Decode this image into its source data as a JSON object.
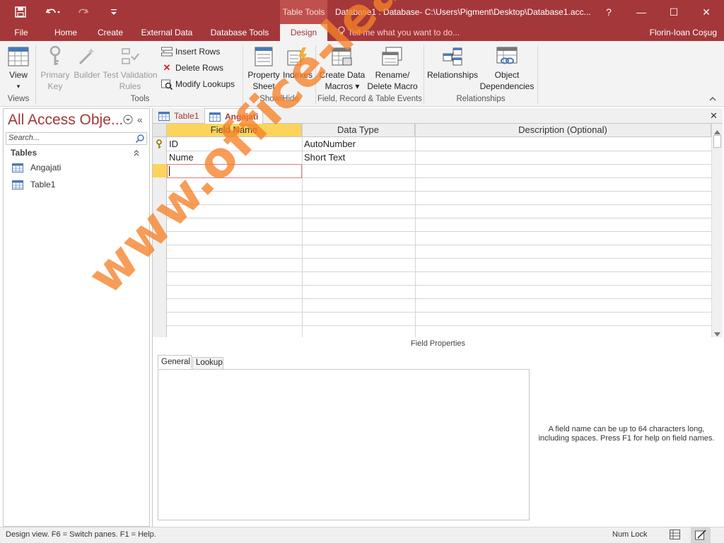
{
  "window": {
    "context_tab": "Table Tools",
    "title": "Database1 : Database- C:\\Users\\Pigment\\Desktop\\Database1.acc...",
    "help": "?",
    "minimize": "—",
    "restore": "☐",
    "close": "✕"
  },
  "qat": {
    "save_icon": "save-icon",
    "undo_icon": "undo-icon",
    "redo_icon": "redo-icon",
    "customize_icon": "customize-qat-icon"
  },
  "tabs": [
    "File",
    "Home",
    "Create",
    "External Data",
    "Database Tools",
    "Design"
  ],
  "active_tab": "Design",
  "tell_me": "Tell me what you want to do...",
  "user": "Florin-Ioan Coşug",
  "ribbon": {
    "view": {
      "line1": "View",
      "line2": "▾"
    },
    "primary_key": {
      "line1": "Primary",
      "line2": "Key"
    },
    "builder": {
      "line1": "Builder"
    },
    "test_validation": {
      "line1": "Test Validation",
      "line2": "Rules"
    },
    "insert_rows": "Insert Rows",
    "delete_rows": "Delete Rows",
    "modify_lookups": "Modify Lookups",
    "property_sheet": {
      "line1": "Property",
      "line2": "Sheet"
    },
    "indexes": {
      "line1": "Indexes"
    },
    "create_data_macros": {
      "line1": "Create Data",
      "line2": "Macros ▾"
    },
    "rename_delete_macro": {
      "line1": "Rename/",
      "line2": "Delete Macro"
    },
    "relationships": {
      "line1": "Relationships"
    },
    "object_dependencies": {
      "line1": "Object",
      "line2": "Dependencies"
    },
    "groups": {
      "views": "Views",
      "tools": "Tools",
      "show_hide": "Show/Hide",
      "field_events": "Field, Record & Table Events",
      "relationships": "Relationships"
    }
  },
  "nav": {
    "title": "All Access Obje...",
    "search_placeholder": "Search...",
    "section": "Tables",
    "items": [
      "Angajati",
      "Table1"
    ]
  },
  "doc_tabs": [
    "Table1",
    "Angajati"
  ],
  "active_doc_tab": "Angajati",
  "grid": {
    "headers": [
      "Field Name",
      "Data Type",
      "Description (Optional)"
    ],
    "rows": [
      {
        "field": "ID",
        "type": "AutoNumber",
        "desc": "",
        "primary_key": true
      },
      {
        "field": "Nume",
        "type": "Short Text",
        "desc": "",
        "primary_key": false
      },
      {
        "field": "",
        "type": "",
        "desc": "",
        "primary_key": false
      }
    ]
  },
  "field_properties": {
    "label": "Field Properties",
    "tabs": [
      "General",
      "Lookup"
    ],
    "active_tab": "General",
    "help": "A field name can be up to 64 characters long, including spaces. Press F1 for help on field names."
  },
  "status": {
    "left": "Design view.  F6 = Switch panes.  F1 = Help.",
    "num_lock": "Num Lock"
  },
  "watermark": "www.office-learning.ro",
  "colors": {
    "accent": "#a4373a",
    "context": "#c0504d",
    "header_selected": "#fbd55b",
    "watermark": "#f58228"
  }
}
